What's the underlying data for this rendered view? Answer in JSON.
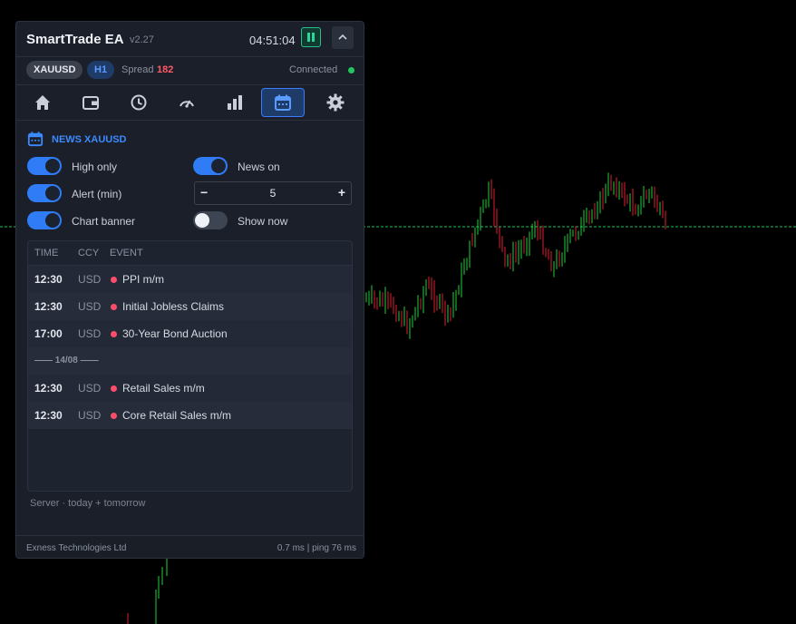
{
  "panel": {
    "title": "SmartTrade EA",
    "version": "v2.27",
    "clock": "04:51:04"
  },
  "status": {
    "symbol": "XAUUSD",
    "timeframe": "H1",
    "spread_label": "Spread",
    "spread_value": "182",
    "connection": "Connected",
    "connection_color": "#22c55e"
  },
  "tabs": [
    {
      "icon": "home-icon"
    },
    {
      "icon": "wallet-icon"
    },
    {
      "icon": "clock-icon"
    },
    {
      "icon": "gauge-icon"
    },
    {
      "icon": "bar-chart-icon"
    },
    {
      "icon": "calendar-icon",
      "active": true
    },
    {
      "icon": "gear-icon"
    }
  ],
  "news": {
    "section_title": "NEWS XAUUSD",
    "toggles": {
      "high_only": {
        "label": "High only",
        "on": true
      },
      "news_on": {
        "label": "News on",
        "on": true
      },
      "alert_min": {
        "label": "Alert (min)",
        "on": true
      },
      "chart_banner": {
        "label": "Chart banner",
        "on": true
      },
      "show_now": {
        "label": "Show now",
        "on": false
      }
    },
    "alert_minutes": "5",
    "stepper_minus": "−",
    "stepper_plus": "+",
    "columns": {
      "time": "TIME",
      "ccy": "CCY",
      "event": "EVENT"
    },
    "rows": [
      {
        "time": "12:30",
        "ccy": "USD",
        "event": "PPI m/m"
      },
      {
        "time": "12:30",
        "ccy": "USD",
        "event": "Initial Jobless Claims"
      },
      {
        "time": "17:00",
        "ccy": "USD",
        "event": "30-Year Bond Auction"
      },
      {
        "separator": "—— 14/08 ——"
      },
      {
        "time": "12:30",
        "ccy": "USD",
        "event": "Retail Sales m/m"
      },
      {
        "time": "12:30",
        "ccy": "USD",
        "event": "Core Retail Sales m/m"
      }
    ],
    "impact_color": "#ff4d6a",
    "footnote": "Server  ·  today + tomorrow"
  },
  "footer": {
    "broker": "Exness Technologies Ltd",
    "latency": "0.7 ms  |  ping 76 ms"
  },
  "colors": {
    "accent": "#2f7cf6",
    "bull": "#1fd13a",
    "bear": "#e01e2e",
    "price_line": "#22c55e"
  }
}
